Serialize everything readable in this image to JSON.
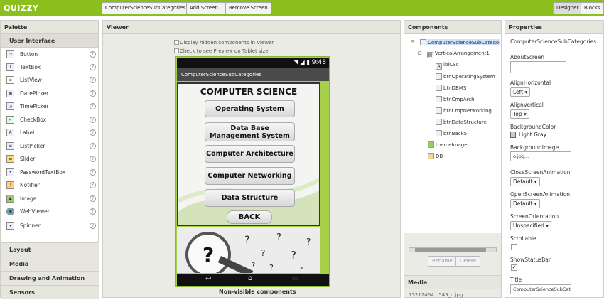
{
  "app": {
    "logo": "QUIZZY",
    "screen_select": "ComputerScienceSubCategories",
    "add_screen": "Add Screen ...",
    "remove_screen": "Remove Screen",
    "designer": "Designer",
    "blocks": "Blocks"
  },
  "palette": {
    "title": "Palette",
    "section": "User Interface",
    "items": [
      {
        "label": "Button",
        "icon": "button-icon"
      },
      {
        "label": "TextBox",
        "icon": "textbox-icon"
      },
      {
        "label": "ListView",
        "icon": "listview-icon"
      },
      {
        "label": "DatePicker",
        "icon": "datepicker-icon"
      },
      {
        "label": "TimePicker",
        "icon": "timepicker-icon"
      },
      {
        "label": "CheckBox",
        "icon": "checkbox-icon"
      },
      {
        "label": "Label",
        "icon": "label-icon"
      },
      {
        "label": "ListPicker",
        "icon": "listpicker-icon"
      },
      {
        "label": "Slider",
        "icon": "slider-icon"
      },
      {
        "label": "PasswordTextBox",
        "icon": "password-icon"
      },
      {
        "label": "Notifier",
        "icon": "notifier-icon"
      },
      {
        "label": "Image",
        "icon": "image-icon"
      },
      {
        "label": "WebViewer",
        "icon": "webviewer-icon"
      },
      {
        "label": "Spinner",
        "icon": "spinner-icon"
      }
    ],
    "help": "?",
    "categories": [
      "Layout",
      "Media",
      "Drawing and Animation",
      "Sensors"
    ]
  },
  "viewer": {
    "title": "Viewer",
    "hidden_label": "Display hidden components in Viewer",
    "tablet_label": "Check to see Preview on Tablet size.",
    "time": "9:48",
    "screen_title": "ComputerScienceSubCategories",
    "heading": "COMPUTER SCIENCE",
    "buttons": [
      "Operating System",
      "Data Base Management System",
      "Computer Architecture",
      "Computer Networking",
      "Data Structure"
    ],
    "back": "BACK",
    "nonvisible": "Non-visible components"
  },
  "components": {
    "title": "Components",
    "root": "ComputerScienceSubCatego",
    "arrangement": "VerticalArrangement1",
    "children": [
      "lblCSc",
      "btnOperatingSystem",
      "btnDBMS",
      "btnCmpArchi",
      "btnCmpNetworking",
      "btnDataStructure",
      "btnBack5"
    ],
    "others": [
      "themeImage",
      "DB"
    ],
    "rename": "Rename",
    "delete": "Delete",
    "media_title": "Media",
    "media_file": "13212464...549_o.jpg"
  },
  "properties": {
    "title": "Properties",
    "component": "ComputerScienceSubCategories",
    "about_label": "AboutScreen",
    "align_h_label": "AlignHorizontal",
    "align_h": "Left",
    "align_v_label": "AlignVertical",
    "align_v": "Top",
    "bgcolor_label": "BackgroundColor",
    "bgcolor": "Light Gray",
    "bgimage_label": "BackgroundImage",
    "bgimage": "o.jpg...",
    "close_anim_label": "CloseScreenAnimation",
    "close_anim": "Default",
    "open_anim_label": "OpenScreenAnimation",
    "open_anim": "Default",
    "orientation_label": "ScreenOrientation",
    "orientation": "Unspecified",
    "scrollable_label": "Scrollable",
    "statusbar_label": "ShowStatusBar",
    "title_label": "Title",
    "title_value": "ComputerScienceSubCate"
  },
  "colors": {
    "accent": "#8bbf1d",
    "phone_frame": "#a8cf4a"
  }
}
